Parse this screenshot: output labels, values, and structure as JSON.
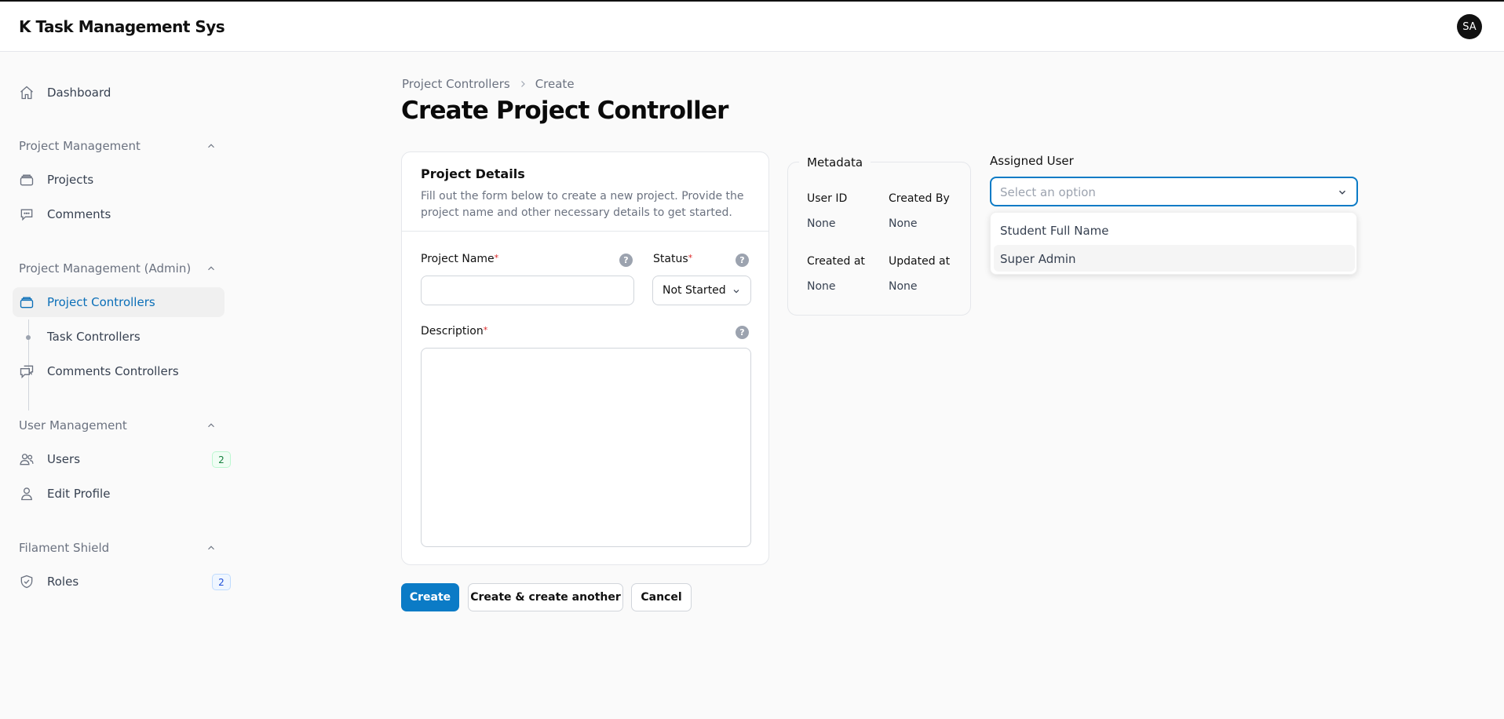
{
  "app": {
    "title": "K Task Management Sys",
    "user_initials": "SA"
  },
  "sidebar": {
    "dashboard": "Dashboard",
    "groups": [
      {
        "label": "Project Management",
        "items": [
          {
            "label": "Projects"
          },
          {
            "label": "Comments"
          }
        ]
      },
      {
        "label": "Project Management (Admin)",
        "items": [
          {
            "label": "Project Controllers",
            "active": true
          },
          {
            "label": "Task Controllers"
          },
          {
            "label": "Comments Controllers"
          }
        ]
      },
      {
        "label": "User Management",
        "items": [
          {
            "label": "Users",
            "badge": "2"
          },
          {
            "label": "Edit Profile"
          }
        ]
      },
      {
        "label": "Filament Shield",
        "items": [
          {
            "label": "Roles",
            "badge": "2"
          }
        ]
      }
    ]
  },
  "breadcrumb": {
    "parent": "Project Controllers",
    "current": "Create"
  },
  "page": {
    "title": "Create Project Controller"
  },
  "form": {
    "section_title": "Project Details",
    "section_desc": "Fill out the form below to create a new project. Provide the project name and other necessary details to get started.",
    "project_name": {
      "label": "Project Name",
      "value": ""
    },
    "status": {
      "label": "Status",
      "value": "Not Started"
    },
    "description": {
      "label": "Description",
      "value": ""
    },
    "required_mark": "*",
    "help_glyph": "?"
  },
  "metadata": {
    "legend": "Metadata",
    "user_id": {
      "label": "User ID",
      "value": "None"
    },
    "created_by": {
      "label": "Created By",
      "value": "None"
    },
    "created_at": {
      "label": "Created at",
      "value": "None"
    },
    "updated_at": {
      "label": "Updated at",
      "value": "None"
    }
  },
  "assigned_user": {
    "label": "Assigned User",
    "placeholder": "Select an option",
    "options": [
      "Student Full Name",
      "Super Admin"
    ]
  },
  "actions": {
    "create": "Create",
    "create_another": "Create & create another",
    "cancel": "Cancel"
  },
  "colors": {
    "primary": "#0b7bc6",
    "active_nav": "#0b6fb8",
    "required": "#dc2626"
  },
  "icons": {
    "dashboard": "home-icon",
    "projects": "archive-icon",
    "comments": "chat-bubble-icon",
    "project_controllers": "archive-icon",
    "comments_controllers": "chat-bubbles-icon",
    "users": "users-icon",
    "edit_profile": "user-icon",
    "roles": "shield-check-icon"
  }
}
